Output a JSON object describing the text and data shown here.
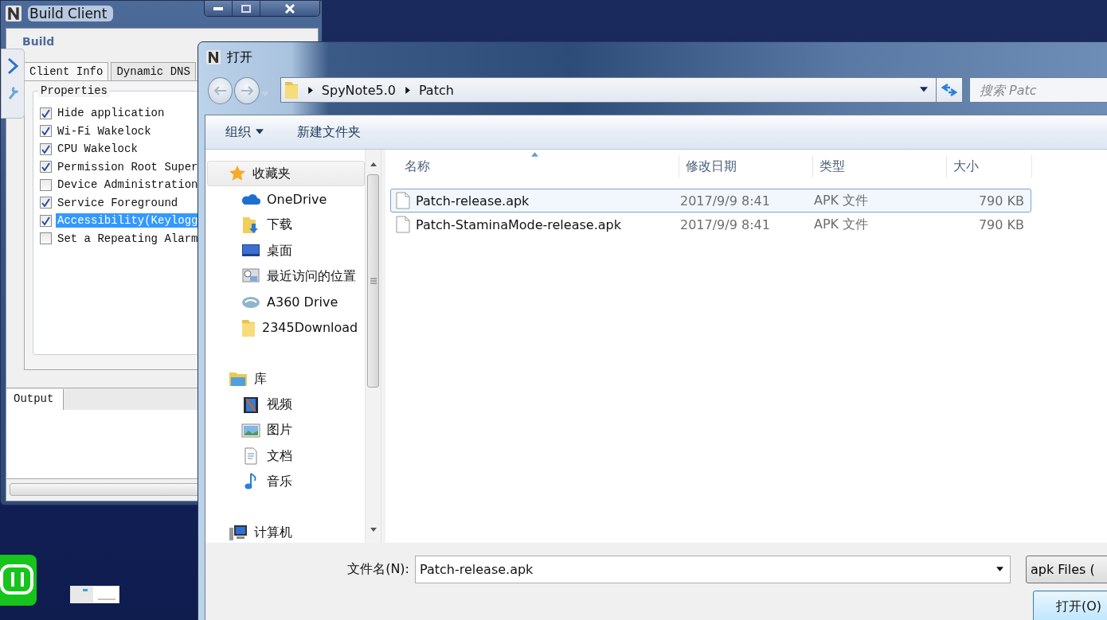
{
  "build_window": {
    "title": "Build Client",
    "section": "Build",
    "tabs": [
      {
        "label": "Client Info",
        "selected": true
      },
      {
        "label": "Dynamic DNS",
        "selected": false
      }
    ],
    "group_title": "Properties",
    "options": [
      {
        "label": "Hide application",
        "checked": true,
        "selected": false
      },
      {
        "label": "Wi-Fi Wakelock",
        "checked": true,
        "selected": false
      },
      {
        "label": "CPU Wakelock",
        "checked": true,
        "selected": false
      },
      {
        "label": "Permission Root Super",
        "checked": true,
        "selected": false
      },
      {
        "label": "Device Administration",
        "checked": false,
        "selected": false
      },
      {
        "label": "Service Foreground",
        "checked": true,
        "selected": false
      },
      {
        "label": "Accessibility(Keylogg",
        "checked": true,
        "selected": true
      },
      {
        "label": "Set a Repeating Alarm",
        "checked": false,
        "selected": false
      }
    ],
    "output_tab": {
      "label": "Output",
      "selected": true
    }
  },
  "dialog": {
    "title": "打开",
    "breadcrumb": [
      "SpyNote5.0",
      "Patch"
    ],
    "search": {
      "placeholder": "搜索 Patc"
    },
    "toolbar": [
      {
        "label": "组织",
        "has_menu": true
      },
      {
        "label": "新建文件夹",
        "has_menu": false
      }
    ],
    "nav": [
      {
        "label": "收藏夹",
        "kind": "favorites",
        "selected": true,
        "children": [
          {
            "label": "OneDrive",
            "kind": "cloud",
            "selected": false
          },
          {
            "label": "下载",
            "kind": "download",
            "selected": false
          },
          {
            "label": "桌面",
            "kind": "desktop",
            "selected": false
          },
          {
            "label": "最近访问的位置",
            "kind": "recent",
            "selected": false
          },
          {
            "label": "A360 Drive",
            "kind": "drive",
            "selected": false
          },
          {
            "label": "2345Download",
            "kind": "folder",
            "selected": false
          }
        ]
      },
      {
        "label": "库",
        "kind": "library",
        "selected": false,
        "children": [
          {
            "label": "视频",
            "kind": "video",
            "selected": false
          },
          {
            "label": "图片",
            "kind": "pictures",
            "selected": false
          },
          {
            "label": "文档",
            "kind": "documents",
            "selected": false
          },
          {
            "label": "音乐",
            "kind": "music",
            "selected": false
          }
        ]
      },
      {
        "label": "计算机",
        "kind": "computer",
        "selected": false
      }
    ],
    "columns": [
      {
        "label": "名称",
        "sorted": true
      },
      {
        "label": "修改日期",
        "sorted": false
      },
      {
        "label": "类型",
        "sorted": false
      },
      {
        "label": "大小",
        "sorted": false
      }
    ],
    "files": [
      {
        "name": "Patch-release.apk",
        "date": "2017/9/9 8:41",
        "type": "APK 文件",
        "size": "790 KB",
        "selected": true
      },
      {
        "name": "Patch-StaminaMode-release.apk",
        "date": "2017/9/9 8:41",
        "type": "APK 文件",
        "size": "790 KB",
        "selected": false
      }
    ],
    "filename_label": "文件名(N):",
    "filename": "Patch-release.apk",
    "filter": "apk Files (",
    "open_button": "打开(O)"
  }
}
